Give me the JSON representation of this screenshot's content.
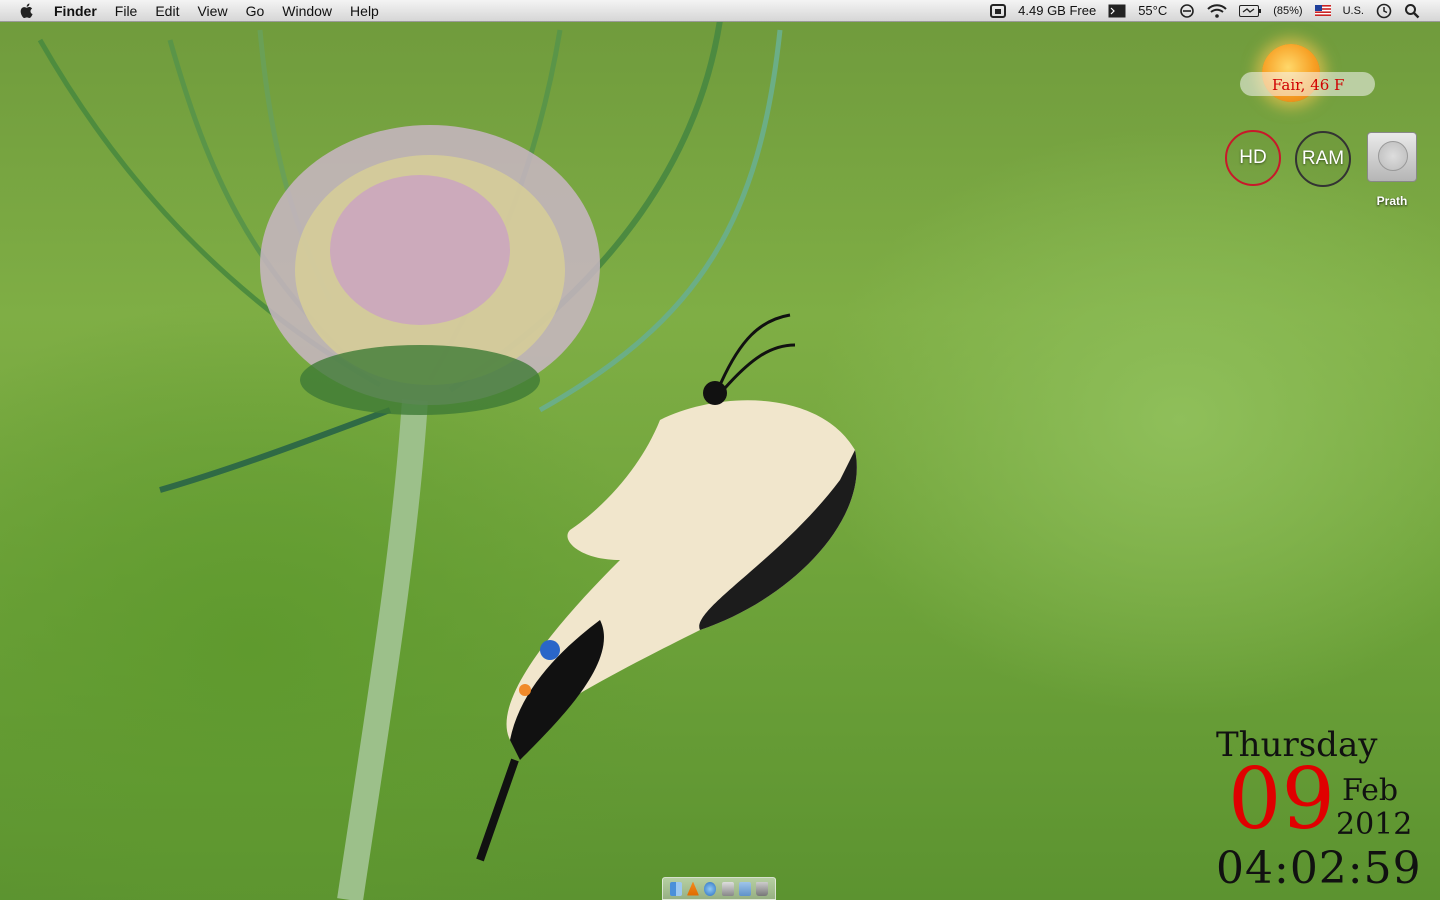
{
  "menubar": {
    "app_name": "Finder",
    "menus": [
      "File",
      "Edit",
      "View",
      "Go",
      "Window",
      "Help"
    ],
    "status": {
      "disk_free": "4.49 GB Free",
      "temperature": "55°C",
      "battery": "(85%)",
      "input_source": "U.S."
    }
  },
  "weather": {
    "text": "Fair, 46 F"
  },
  "gauges": {
    "hd_label": "HD",
    "ram_label": "RAM"
  },
  "drive": {
    "label": "Prath"
  },
  "clock": {
    "day": "Thursday",
    "date": "09",
    "month": "Feb",
    "year": "2012",
    "time": "04:02:59"
  },
  "colors": {
    "accent_red": "#e00000",
    "hd_ring": "#c8182a",
    "wallpaper_green": "#7fae45"
  },
  "icons": [
    "apple-icon",
    "drive-status-icon",
    "terminal-icon",
    "sync-icon",
    "wifi-icon",
    "battery-icon",
    "flag-icon",
    "clock-icon",
    "search-icon",
    "finder-icon",
    "vlc-icon",
    "safari-icon",
    "preview-icon",
    "folder-icon",
    "trash-icon"
  ]
}
